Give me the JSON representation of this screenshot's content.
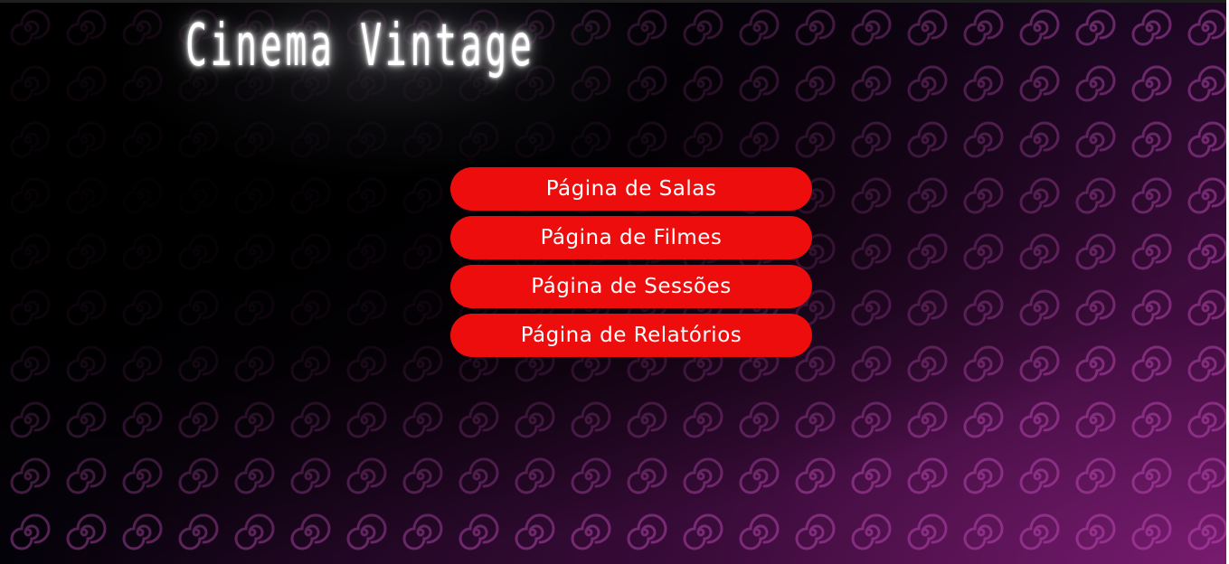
{
  "site": {
    "title": "Cinema Vintage"
  },
  "nav": {
    "items": [
      {
        "label": "Página de Salas"
      },
      {
        "label": "Página de Filmes"
      },
      {
        "label": "Página de Sessões"
      },
      {
        "label": "Página de Relatórios"
      }
    ]
  },
  "theme": {
    "button_color": "#ee0d0d",
    "title_color": "#ffffff",
    "background_accent": "#8a1f86"
  }
}
